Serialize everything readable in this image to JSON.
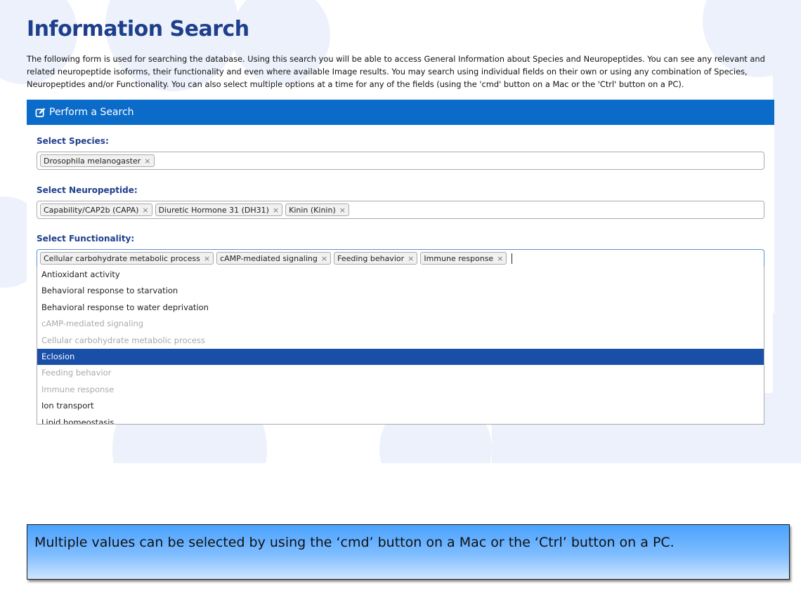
{
  "page": {
    "title": "Information Search",
    "intro": "The following form is used for searching the database. Using this search you will be able to access General Information about Species and Neuropeptides. You can see any relevant and related neuropeptide isoforms, their functionality and even where available Image results. You may search using individual fields on their own or using any combination of Species, Neuropeptides and/or Functionality. You can also select multiple options at a time for any of the fields (using the 'cmd' button on a Mac or the 'Ctrl' button on a PC)."
  },
  "panel": {
    "header": "Perform a Search",
    "header_icon": "edit-icon"
  },
  "species": {
    "label": "Select Species:",
    "tags": [
      "Drosophila melanogaster"
    ]
  },
  "neuropeptide": {
    "label": "Select Neuropeptide:",
    "tags": [
      "Capability/CAP2b (CAPA)",
      "Diuretic Hormone 31 (DH31)",
      "Kinin (Kinin)"
    ]
  },
  "functionality": {
    "label": "Select Functionality:",
    "tags": [
      "Cellular carbohydrate metabolic process",
      "cAMP-mediated signaling",
      "Feeding behavior",
      "Immune response"
    ],
    "options": [
      {
        "label": "Antioxidant activity",
        "state": "normal"
      },
      {
        "label": "Behavioral response to starvation",
        "state": "normal"
      },
      {
        "label": "Behavioral response to water deprivation",
        "state": "normal"
      },
      {
        "label": "cAMP-mediated signaling",
        "state": "disabled"
      },
      {
        "label": "Cellular carbohydrate metabolic process",
        "state": "disabled"
      },
      {
        "label": "Eclosion",
        "state": "highlighted"
      },
      {
        "label": "Feeding behavior",
        "state": "disabled"
      },
      {
        "label": "Immune response",
        "state": "disabled"
      },
      {
        "label": "Ion transport",
        "state": "normal"
      },
      {
        "label": "Lipid homeostasis",
        "state": "normal"
      }
    ]
  },
  "tag_remove_glyph": "×",
  "note": "Multiple values can be selected by using the ‘cmd’ button on a Mac or the ‘Ctrl’ button on a PC.",
  "colors": {
    "title": "#1e3f8c",
    "header_bg": "#0b6bc8",
    "highlight_bg": "#1a4fa8",
    "disabled_text": "#aaaaaa"
  }
}
